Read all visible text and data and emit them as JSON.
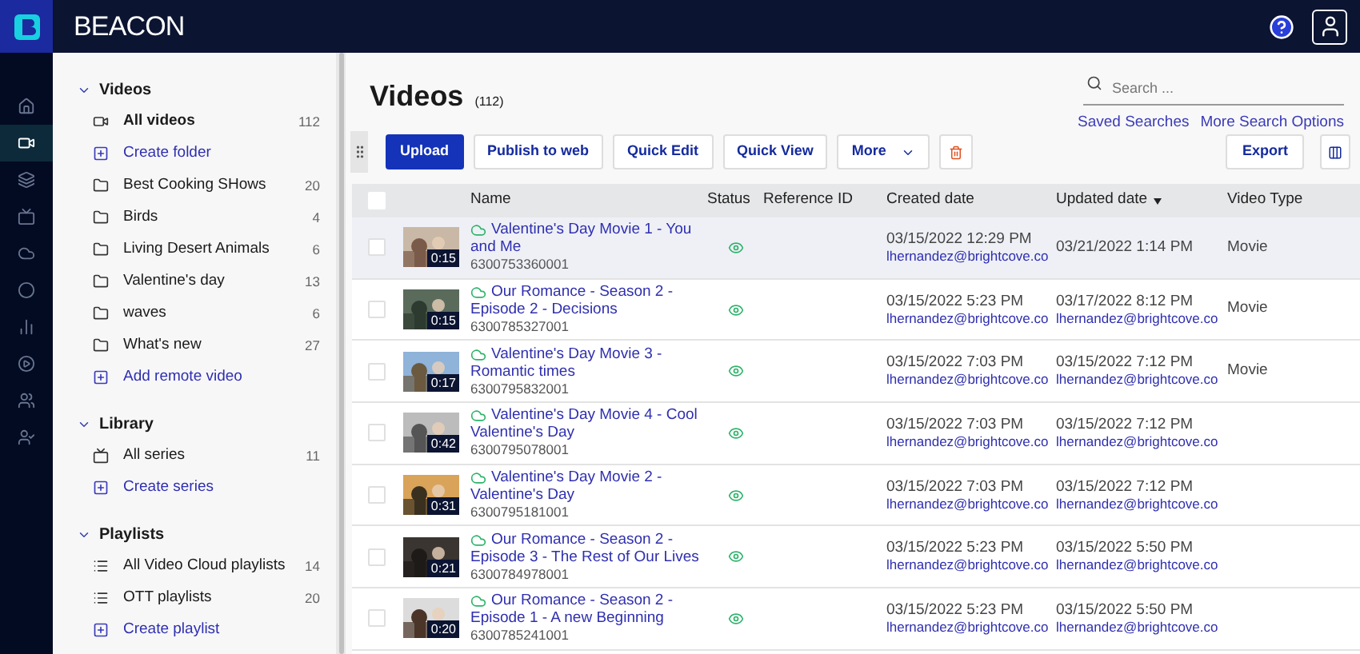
{
  "app": {
    "name": "BEACON"
  },
  "rail": [
    {
      "selected": false
    },
    {
      "selected": true
    },
    {
      "selected": false
    },
    {
      "selected": false
    },
    {
      "selected": false
    },
    {
      "selected": false
    },
    {
      "selected": false
    },
    {
      "selected": false
    },
    {
      "selected": false
    },
    {
      "selected": false
    }
  ],
  "sidebar": [
    {
      "title": "Videos",
      "expanded": true,
      "items": [
        {
          "kind": "video",
          "label": "All videos",
          "count": "112",
          "selected": true
        },
        {
          "kind": "add",
          "label": "Create folder",
          "selected": false
        },
        {
          "kind": "folder",
          "label": "Best Cooking SHows",
          "count": "20",
          "selected": false
        },
        {
          "kind": "folder",
          "label": "Birds",
          "count": "4",
          "selected": false
        },
        {
          "kind": "folder",
          "label": "Living Desert Animals",
          "count": "6",
          "selected": false
        },
        {
          "kind": "folder",
          "label": "Valentine's day",
          "count": "13",
          "selected": false
        },
        {
          "kind": "folder",
          "label": "waves",
          "count": "6",
          "selected": false
        },
        {
          "kind": "folder",
          "label": "What's new",
          "count": "27",
          "selected": false
        },
        {
          "kind": "add",
          "label": "Add remote video",
          "selected": false
        }
      ]
    },
    {
      "title": "Library",
      "expanded": true,
      "items": [
        {
          "kind": "series",
          "label": "All series",
          "count": "11",
          "selected": false
        },
        {
          "kind": "add",
          "label": "Create series",
          "selected": false
        }
      ]
    },
    {
      "title": "Playlists",
      "expanded": true,
      "items": [
        {
          "kind": "playlist",
          "label": "All Video Cloud playlists",
          "count": "14",
          "selected": false
        },
        {
          "kind": "playlist",
          "label": "OTT playlists",
          "count": "20",
          "selected": false
        },
        {
          "kind": "add",
          "label": "Create playlist",
          "selected": false
        }
      ]
    }
  ],
  "page": {
    "title": "Videos",
    "count": "(112)"
  },
  "search": {
    "placeholder": "Search ...",
    "links": [
      "Saved Searches",
      "More Search Options"
    ]
  },
  "toolbar": [
    {
      "kind": "primary",
      "label": "Upload"
    },
    {
      "kind": "plain",
      "label": "Publish to web"
    },
    {
      "kind": "plain",
      "label": "Quick Edit"
    },
    {
      "kind": "plain",
      "label": "Quick View"
    },
    {
      "kind": "menu",
      "label": "More"
    },
    {
      "kind": "delete"
    }
  ],
  "toolbar_right": [
    {
      "kind": "plain",
      "label": "Export"
    },
    {
      "kind": "columns"
    }
  ],
  "table": {
    "select_all": {
      "checked": false
    },
    "columns": [
      {
        "label": "Name",
        "sorted": false
      },
      {
        "label": "Status",
        "sorted": false
      },
      {
        "label": "Reference ID",
        "sorted": false
      },
      {
        "label": "Created date",
        "sorted": false
      },
      {
        "label": "Updated date",
        "sorted": true
      },
      {
        "label": "Video Type",
        "sorted": false
      }
    ],
    "rows": [
      {
        "selected": true,
        "checked": false,
        "duration": "0:15",
        "name": "Valentine's Day Movie 1 - You and Me",
        "id": "6300753360001",
        "created": "03/15/2022 12:29 PM",
        "created_by": "lhernandez@brightcove.co",
        "updated": "03/21/2022 1:14 PM",
        "type": "Movie"
      },
      {
        "selected": false,
        "checked": false,
        "duration": "0:15",
        "name": "Our Romance - Season 2 - Episode 2 - Decisions",
        "id": "6300785327001",
        "created": "03/15/2022 5:23 PM",
        "created_by": "lhernandez@brightcove.co",
        "updated": "03/17/2022 8:12 PM",
        "updated_by": "lhernandez@brightcove.co",
        "type": "Movie"
      },
      {
        "selected": false,
        "checked": false,
        "duration": "0:17",
        "name": "Valentine's Day Movie 3 - Romantic times",
        "id": "6300795832001",
        "created": "03/15/2022 7:03 PM",
        "created_by": "lhernandez@brightcove.co",
        "updated": "03/15/2022 7:12 PM",
        "updated_by": "lhernandez@brightcove.co",
        "type": "Movie"
      },
      {
        "selected": false,
        "checked": false,
        "duration": "0:42",
        "name": "Valentine's Day Movie 4 - Cool Valentine's Day",
        "id": "6300795078001",
        "created": "03/15/2022 7:03 PM",
        "created_by": "lhernandez@brightcove.co",
        "updated": "03/15/2022 7:12 PM",
        "updated_by": "lhernandez@brightcove.co"
      },
      {
        "selected": false,
        "checked": false,
        "duration": "0:31",
        "name": "Valentine's Day Movie 2 - Valentine's Day",
        "id": "6300795181001",
        "created": "03/15/2022 7:03 PM",
        "created_by": "lhernandez@brightcove.co",
        "updated": "03/15/2022 7:12 PM",
        "updated_by": "lhernandez@brightcove.co"
      },
      {
        "selected": false,
        "checked": false,
        "duration": "0:21",
        "name": "Our Romance - Season 2 - Episode 3 - The Rest of Our Lives",
        "id": "6300784978001",
        "created": "03/15/2022 5:23 PM",
        "created_by": "lhernandez@brightcove.co",
        "updated": "03/15/2022 5:50 PM",
        "updated_by": "lhernandez@brightcove.co"
      },
      {
        "selected": false,
        "checked": false,
        "duration": "0:20",
        "name": "Our Romance - Season 2 - Episode 1 - A new Beginning",
        "id": "6300785241001",
        "created": "03/15/2022 5:23 PM",
        "created_by": "lhernandez@brightcove.co",
        "updated": "03/15/2022 5:50 PM",
        "updated_by": "lhernandez@brightcove.co"
      }
    ]
  }
}
